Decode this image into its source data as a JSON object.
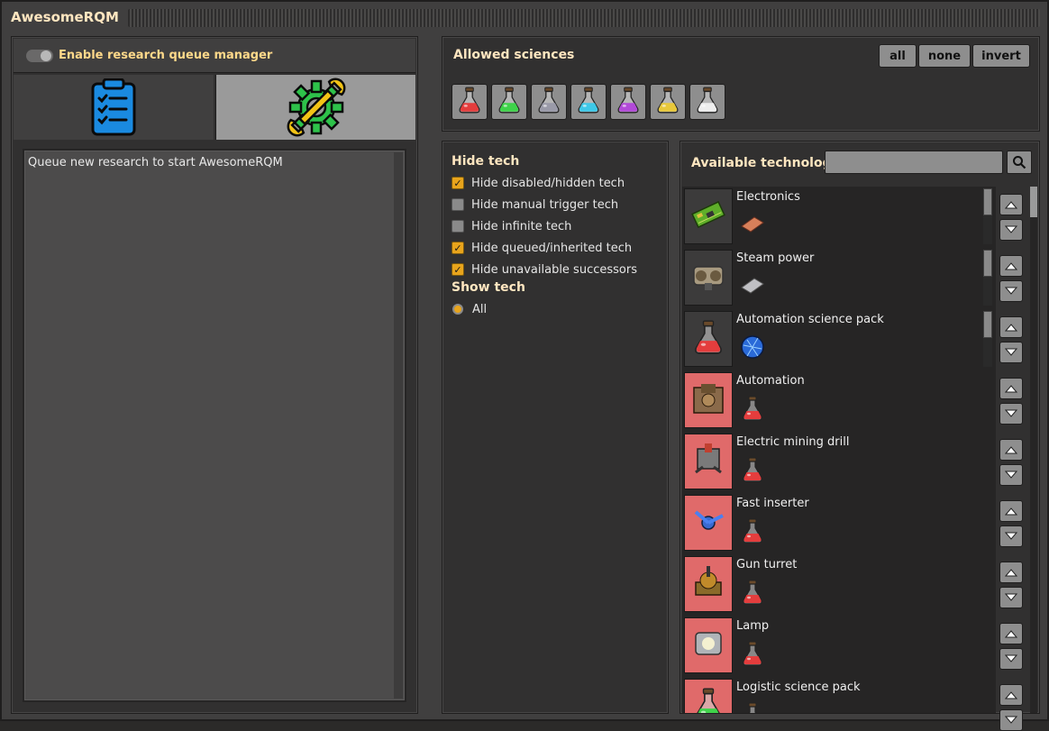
{
  "window": {
    "title": "AwesomeRQM"
  },
  "left": {
    "enable_label": "Enable research queue manager",
    "tabs": [
      {
        "name": "queue",
        "icon": "checklist-icon",
        "selected": true
      },
      {
        "name": "settings",
        "icon": "wrench-gear-icon",
        "selected": false
      }
    ],
    "queue_empty_text": "Queue new research to start AwesomeRQM"
  },
  "sciences": {
    "header": "Allowed sciences",
    "buttons": {
      "all": "all",
      "none": "none",
      "invert": "invert"
    },
    "packs": [
      {
        "icon": "red-science-flask-icon",
        "color": "#e43d3d"
      },
      {
        "icon": "green-science-flask-icon",
        "color": "#3fd34a"
      },
      {
        "icon": "gray-science-flask-icon",
        "color": "#9a9aa8"
      },
      {
        "icon": "cyan-science-flask-icon",
        "color": "#3ec8e8"
      },
      {
        "icon": "purple-science-flask-icon",
        "color": "#b24ad8"
      },
      {
        "icon": "yellow-science-flask-icon",
        "color": "#e8c83a"
      },
      {
        "icon": "white-science-flask-icon",
        "color": "#eeeeee"
      }
    ]
  },
  "filters": {
    "hide_header": "Hide tech",
    "hide_options": [
      {
        "label": "Hide disabled/hidden tech",
        "checked": true
      },
      {
        "label": "Hide manual trigger tech",
        "checked": false
      },
      {
        "label": "Hide infinite tech",
        "checked": false
      },
      {
        "label": "Hide queued/inherited tech",
        "checked": true
      },
      {
        "label": "Hide unavailable successors",
        "checked": true
      }
    ],
    "show_header": "Show tech",
    "show_options": [
      {
        "label": "All",
        "selected": true
      }
    ]
  },
  "tech": {
    "header": "Available technology",
    "search_value": "",
    "items": [
      {
        "name": "Electronics",
        "icon": "electronics-circuit-icon",
        "highlight": false,
        "prereq": "copper-plate-icon"
      },
      {
        "name": "Steam power",
        "icon": "steam-engine-icon",
        "highlight": false,
        "prereq": "iron-plate-icon"
      },
      {
        "name": "Automation science pack",
        "icon": "red-flask-icon",
        "highlight": false,
        "prereq": "blue-lab-orb-icon"
      },
      {
        "name": "Automation",
        "icon": "assembler-icon",
        "highlight": true,
        "prereq": "red-science-flask-icon"
      },
      {
        "name": "Electric mining drill",
        "icon": "mining-drill-icon",
        "highlight": true,
        "prereq": "red-science-flask-icon"
      },
      {
        "name": "Fast inserter",
        "icon": "fast-inserter-icon",
        "highlight": true,
        "prereq": "red-science-flask-icon"
      },
      {
        "name": "Gun turret",
        "icon": "gun-turret-icon",
        "highlight": true,
        "prereq": "red-science-flask-icon"
      },
      {
        "name": "Lamp",
        "icon": "lamp-icon",
        "highlight": true,
        "prereq": "red-science-flask-icon"
      },
      {
        "name": "Logistic science pack",
        "icon": "green-flask-icon",
        "highlight": true,
        "prereq": "red-science-flask-icon"
      }
    ]
  }
}
